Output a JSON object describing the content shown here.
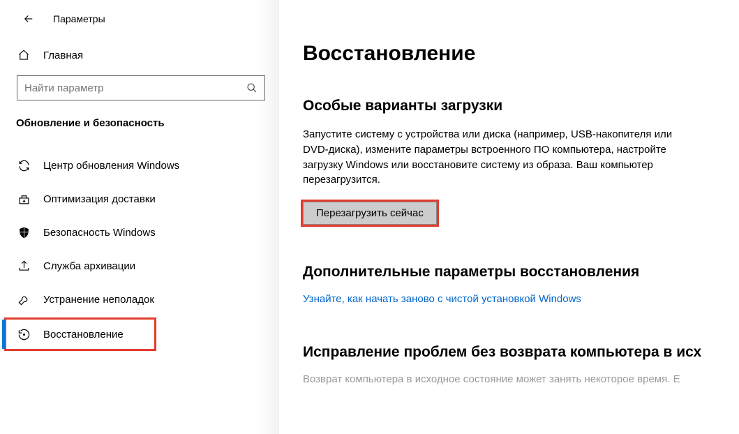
{
  "header": {
    "title": "Параметры"
  },
  "home": {
    "label": "Главная"
  },
  "search": {
    "placeholder": "Найти параметр"
  },
  "section_title": "Обновление и безопасность",
  "nav": [
    {
      "label": "Центр обновления Windows"
    },
    {
      "label": "Оптимизация доставки"
    },
    {
      "label": "Безопасность Windows"
    },
    {
      "label": "Служба архивации"
    },
    {
      "label": "Устранение неполадок"
    },
    {
      "label": "Восстановление"
    }
  ],
  "page": {
    "title": "Восстановление",
    "section1": {
      "heading": "Особые варианты загрузки",
      "body": "Запустите систему с устройства или диска (например, USB-накопителя или DVD-диска), измените параметры встроенного ПО компьютера, настройте загрузку Windows или восстановите систему из образа. Ваш компьютер перезагрузится.",
      "button": "Перезагрузить сейчас"
    },
    "section2": {
      "heading": "Дополнительные параметры восстановления",
      "link": "Узнайте, как начать заново с чистой установкой Windows"
    },
    "section3": {
      "heading": "Исправление проблем без возврата компьютера в исх",
      "faded": "Возврат компьютера в исходное состояние может занять некоторое время. Е"
    }
  }
}
